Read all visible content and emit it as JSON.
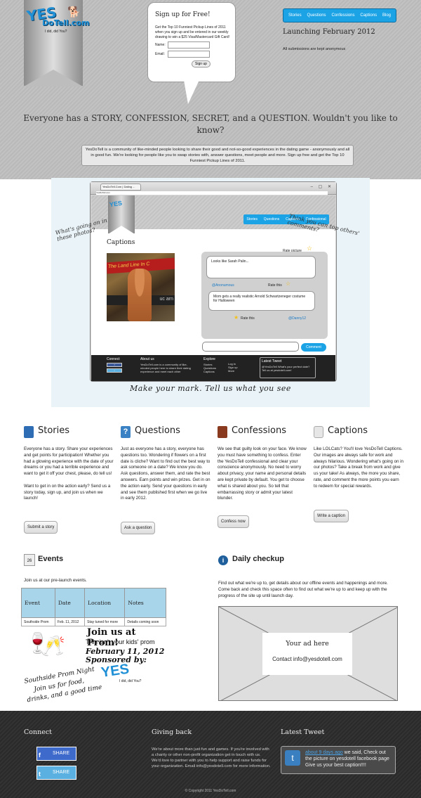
{
  "header": {
    "logo": {
      "name": "YesDoTell.com",
      "tagline": "I did, did You?"
    },
    "signup": {
      "title": "Sign up for Free!",
      "text": "Get the Top 10 Funniest Pickup Lines of 2011 when you sign up and be entered in our weekly drawing to win a $25 Visa/Mastercard Gift Card!",
      "name_label": "Name:",
      "email_label": "Email:",
      "button": "Sign up"
    },
    "nav": [
      "Stories",
      "Questions",
      "Confessions",
      "Captions",
      "Blog"
    ],
    "launch": "Launching February 2012",
    "anon": "All submissions are kept anonymous",
    "tagline": "Everyone has a STORY, CONFESSION, SECRET, and a QUESTION. Wouldn't you like to know?",
    "intro": "YesDoTell is a community of like-minded people looking to share their good and not-so-good experiences in the dating game - anonymously and all in good fun. We're looking for people like you to swap stories with, answer questions, meet people and more. Sign up free and get the Top 10 Funniest Pickup Lines of 2011."
  },
  "preview": {
    "tab": "YesDoTell.Com | Dating ...",
    "url": "YesDoTell.com",
    "controls": "– ▢ ✕",
    "nav": [
      "Stories",
      "Questions",
      "Captions",
      "Confessional"
    ],
    "title": "Captions",
    "rate_picture": "Rate picture",
    "photo_banner": "The Land Line In C",
    "photo_board": "uc arn",
    "comment1": "Looks like Sarah Palin...",
    "handle1": "@Anonumous",
    "rate_this": "Rate this",
    "comment2": "Mom gets a really realistic Arnold Schwartzeneger costume for Halloween",
    "handle2": "@Danny12",
    "comment_button": "Comment",
    "note_left": "What's going on in these photos?",
    "note_right": "Think you can top others' comments?",
    "caption": "Make your mark. Tell us what you see",
    "footer": {
      "connect": "Connect",
      "about_title": "About us",
      "about": "YesDoTell.com is a community of like-minded people here to share their dating experience and meet each other",
      "explore": "Explore",
      "explore_links": [
        "Stories",
        "Questions",
        "Captions"
      ],
      "account_links": [
        "Log in",
        "Sign up",
        "More"
      ],
      "tweet_title": "Latest Tweet",
      "tweet": "@YesDoTell What's your perfect date? Tell us at yesdotell.com!"
    }
  },
  "features": [
    {
      "title": "Stories",
      "text": "Everyone has a story. Share your experiences and get points for participation! Whether you had a glowing experience with the date of your dreams or you had a terrible experience and want to get it off your chest, please, do tell us!\n\nWant to get in on the action early? Send us a story today, sign up, and join us when we launch!",
      "button": "Submit a story",
      "icon_color": "#2e6db4"
    },
    {
      "title": "Questions",
      "text": "Just as everyone has a story, everyone has questions too. Wondering if flowers on a first date is cliche? Want to find out the best way to ask someone on a date? We know you do. Ask questions, answer them, and rate the best answers. Earn points and win prizes. Get in on the action early. Send your questions in early and see them published first when we go live in early 2012.",
      "button": "Ask a question",
      "icon_color": "#3a82c4"
    },
    {
      "title": "Confessions",
      "text": "We see that guilty look on your face. We know you must have something to confess. Enter the YesDoTell confessional and clear your conscience anonymously. No need to worry about privacy, your name and personal details are kept private by default. You get to choose what is shared about you. So tell that embarrassing story or admit your latest blunder.",
      "button": "Confess now",
      "icon_color": "#8a3b1f"
    },
    {
      "title": "Captions",
      "text": "Like LOLCats? You'll love YesDoTell Captions. Our images are always safe for work and always hilarious. Wondering what's going on in our photos? Take a break from work and give us your take! As always, the more you share, rate, and comment the more points you earn to redeem for special rewards.",
      "button": "Write a caption",
      "icon_color": "#cfcfcf"
    }
  ],
  "events": {
    "title": "Events",
    "icon_day": "26",
    "intro": "Join us at our pre-launch events.",
    "columns": [
      "Event",
      "Date",
      "Location",
      "Notes"
    ],
    "rows": [
      [
        "Southside Prom",
        "Feb. 11, 2012",
        "Stay tuned for more",
        "Details coming soon"
      ]
    ],
    "promo": {
      "join": "Join us at Prom!",
      "sub": "This isn't your kids' prom",
      "date": "February 11, 2012",
      "sponsored": "Sponsored by:",
      "night": "Southside Prom Night",
      "food": "Join us for food,",
      "drinks": "drinks, and a good time",
      "logo_tag": "I did, did You?"
    }
  },
  "daily": {
    "title": "Daily checkup",
    "text": "Find out what we're up to, get details about our offline events and happenings and more. Come back and check this space often to find out what we're up to and keep up with the progress of the site up until launch day.",
    "ad_title": "Your ad here",
    "ad_contact": "Contact info@yesdotell.com"
  },
  "footer": {
    "connect": "Connect",
    "share_fb": "SHARE",
    "share_tw": "SHARE",
    "giving_title": "Giving back",
    "giving_text": "We're about more than just fun and games. If you're involved with a charity or other non-profit organization get in touch with us. We'd love to partner with you to help support and raise funds for your organization. Email info@yesdotell.com for more information.",
    "tweet_title": "Latest Tweet",
    "tweet_link": "about 9 days ago",
    "tweet_text": " we said, Check out the picture on yesdotell facebook page Give us your best caption!!!!",
    "copyright": "© Copyright 2011 YesDoTell.com"
  },
  "colors": {
    "accent": "#1ba3e6",
    "header_bg": "#bdbdbd",
    "footer_bg": "#2e2e2e",
    "table_header": "#a8d5ea"
  }
}
